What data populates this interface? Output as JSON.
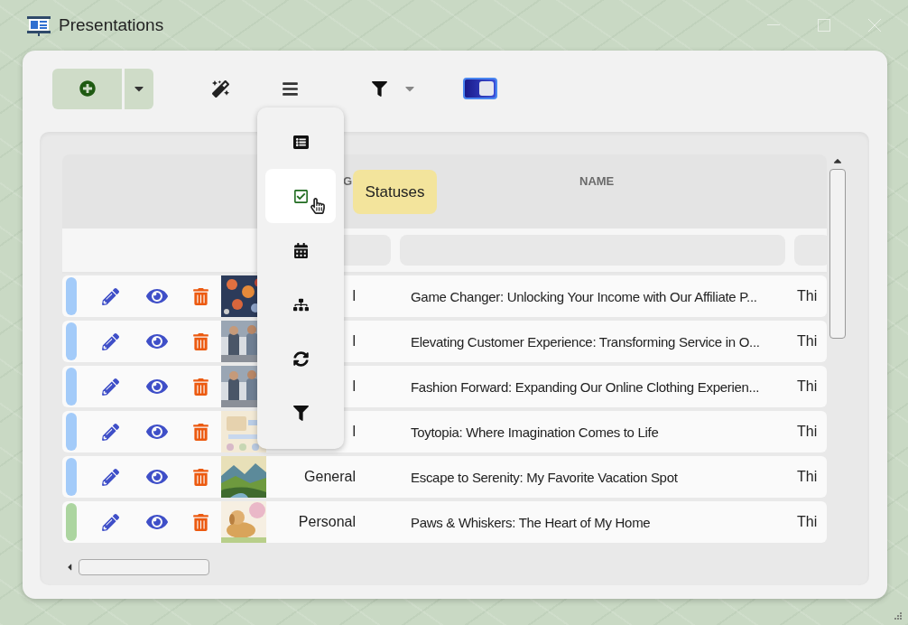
{
  "window": {
    "title": "Presentations"
  },
  "toolbar": {
    "toggle_on": true
  },
  "view_menu": {
    "items": [
      {
        "kind": "list",
        "selected": false
      },
      {
        "kind": "statuses",
        "selected": true
      },
      {
        "kind": "calendar",
        "selected": false
      },
      {
        "kind": "tree",
        "selected": false
      },
      {
        "kind": "refresh",
        "selected": false
      },
      {
        "kind": "filter",
        "selected": false
      }
    ]
  },
  "tooltip": "Statuses",
  "table": {
    "columns": [
      {
        "label": "G"
      },
      {
        "label": "NAME"
      }
    ],
    "rows": [
      {
        "color": "#a3cbf9",
        "group": "l",
        "name": "Game Changer: Unlocking Your Income with Our Affiliate P...",
        "description": "Thi"
      },
      {
        "color": "#a3cbf9",
        "group": "l",
        "name": "Elevating Customer Experience: Transforming Service in O...",
        "description": "Thi"
      },
      {
        "color": "#a3cbf9",
        "group": "l",
        "name": "Fashion Forward: Expanding Our Online Clothing Experien...",
        "description": "Thi"
      },
      {
        "color": "#a3cbf9",
        "group": "l",
        "name": "Toytopia: Where Imagination Comes to Life",
        "description": "Thi"
      },
      {
        "color": "#a3cbf9",
        "group": "General",
        "name": "Escape to Serenity: My Favorite Vacation Spot",
        "description": "Thi"
      },
      {
        "color": "#acd5a0",
        "group": "Personal",
        "name": "Paws & Whiskers: The Heart of My Home",
        "description": "Thi"
      }
    ]
  }
}
